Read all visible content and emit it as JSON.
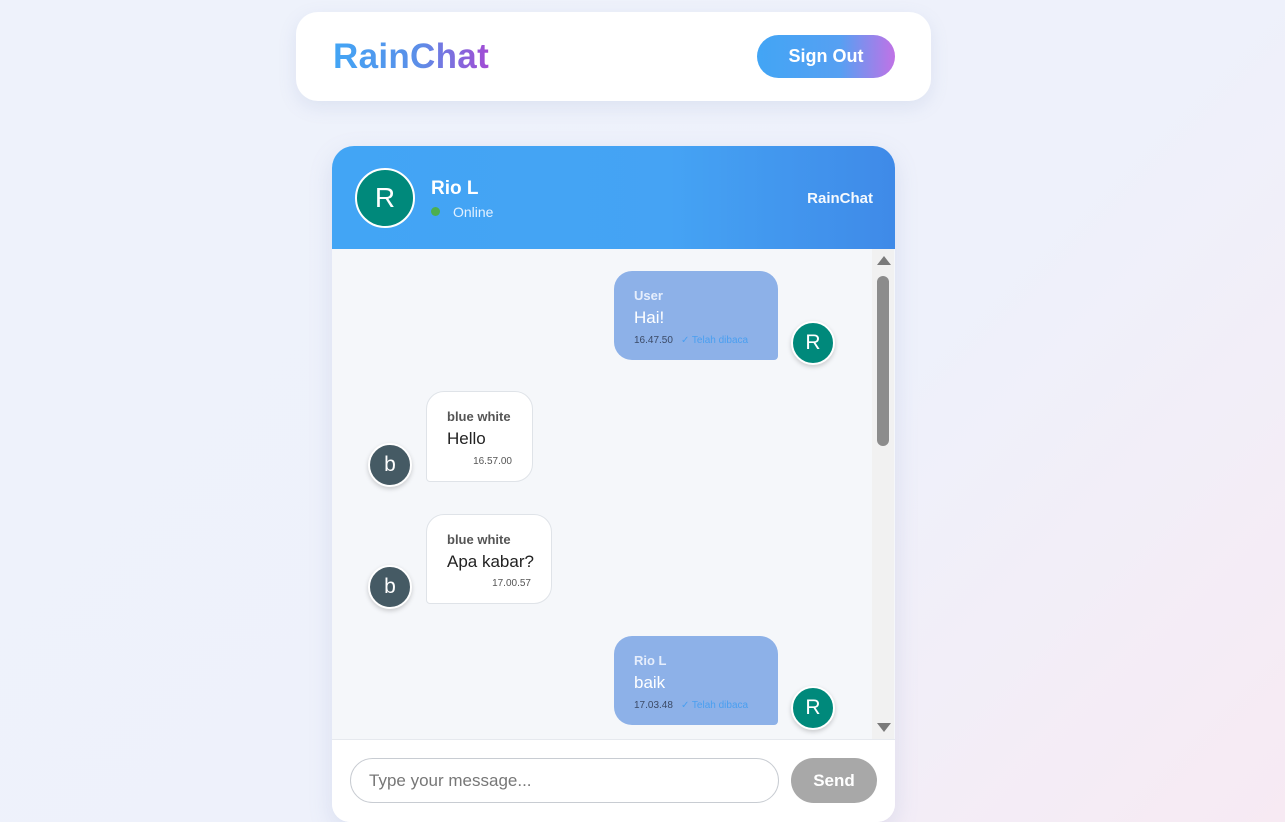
{
  "app": {
    "brand": "RainChat",
    "sign_out_label": "Sign Out"
  },
  "chat_header": {
    "avatar_letter": "R",
    "contact_name": "Rio L",
    "status": "Online",
    "brand": "RainChat"
  },
  "messages": [
    {
      "sender": "User",
      "text": "Hai!",
      "time": "16.47.50",
      "read_receipt": "✓ Telah dibaca",
      "avatar_letter": "R",
      "outgoing": true
    },
    {
      "sender": "blue white",
      "text": "Hello",
      "time": "16.57.00",
      "avatar_letter": "b",
      "outgoing": false
    },
    {
      "sender": "blue white",
      "text": "Apa kabar?",
      "time": "17.00.57",
      "avatar_letter": "b",
      "outgoing": false
    },
    {
      "sender": "Rio L",
      "text": "baik",
      "time": "17.03.48",
      "read_receipt": "✓ Telah dibaca",
      "avatar_letter": "R",
      "outgoing": true
    }
  ],
  "composer": {
    "placeholder": "Type your message...",
    "value": "",
    "send_label": "Send"
  },
  "colors": {
    "brand_blue": "#42a5f5",
    "brand_purple": "#a24bd4",
    "outgoing_bubble": "#8db1e8",
    "avatar_teal": "#00897b",
    "avatar_slate": "#455a64",
    "online": "#4caf50",
    "send_disabled": "#a8a8a8"
  },
  "icons": [
    "scroll-up-arrow-icon",
    "scroll-down-arrow-icon",
    "online-dot-icon"
  ]
}
